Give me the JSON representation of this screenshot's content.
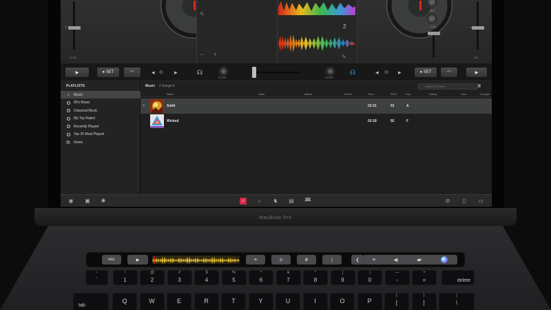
{
  "app": {
    "playlists_title": "PLAYLISTS",
    "playlists": [
      {
        "label": "Music",
        "icon": "music-library-icon",
        "selected": true
      },
      {
        "label": "90's Music",
        "icon": "smart-playlist-icon",
        "selected": false
      },
      {
        "label": "Classical Music",
        "icon": "smart-playlist-icon",
        "selected": false
      },
      {
        "label": "My Top Rated",
        "icon": "smart-playlist-icon",
        "selected": false
      },
      {
        "label": "Recently Played",
        "icon": "smart-playlist-icon",
        "selected": false
      },
      {
        "label": "Top 25 Most Played",
        "icon": "smart-playlist-icon",
        "selected": false
      },
      {
        "label": "Demo",
        "icon": "playlist-icon",
        "selected": false
      }
    ],
    "library": {
      "title": "Music",
      "count": "2 Songs ▾",
      "search_placeholder": "Search iTunes",
      "columns": {
        "name": "Name",
        "artist": "Artist",
        "album": "Album",
        "genre": "Genre",
        "time": "Time",
        "bpm": "BPM",
        "key": "Key",
        "rating": "Rating",
        "year": "Year",
        "grouping": "Groupin"
      },
      "tracks": [
        {
          "name": "Solid",
          "time": "02:31",
          "bpm": "91",
          "key": "A",
          "selected": true
        },
        {
          "name": "Wicked",
          "time": "02:18",
          "bpm": "92",
          "key": "F",
          "selected": false
        }
      ]
    },
    "decks": {
      "left_pitch": "0.0%",
      "right_pitch": "0%",
      "left_beat": "2",
      "right_beat": "2",
      "hi_label": "HIGH",
      "mid_label": "MID",
      "low_label": "LOW",
      "left_minus": "−",
      "left_plus": "+"
    },
    "transport": {
      "set_label": "SET",
      "filter_label": "FILTER"
    }
  },
  "device": {
    "model_label": "MacBook Pro",
    "touchbar": {
      "esc": "esc"
    },
    "keyboard": {
      "number_row": [
        {
          "top": "~",
          "bot": "`"
        },
        {
          "top": "!",
          "bot": "1"
        },
        {
          "top": "@",
          "bot": "2"
        },
        {
          "top": "#",
          "bot": "3"
        },
        {
          "top": "$",
          "bot": "4"
        },
        {
          "top": "%",
          "bot": "5"
        },
        {
          "top": "^",
          "bot": "6"
        },
        {
          "top": "&",
          "bot": "7"
        },
        {
          "top": "*",
          "bot": "8"
        },
        {
          "top": "(",
          "bot": "9"
        },
        {
          "top": ")",
          "bot": "0"
        },
        {
          "top": "—",
          "bot": "-"
        },
        {
          "top": "+",
          "bot": "="
        }
      ],
      "delete": "delete",
      "tab": "tab",
      "letter_row": [
        "Q",
        "W",
        "E",
        "R",
        "T",
        "Y",
        "U",
        "I",
        "O",
        "P"
      ],
      "bracket_keys": [
        {
          "top": "{",
          "bot": "["
        },
        {
          "top": "}",
          "bot": "]"
        },
        {
          "top": "|",
          "bot": "\\"
        }
      ]
    }
  },
  "colors": {
    "accent_red": "#e0261c",
    "art_solid": "#d9a12a",
    "art_wicked": "#3aa7c9"
  }
}
